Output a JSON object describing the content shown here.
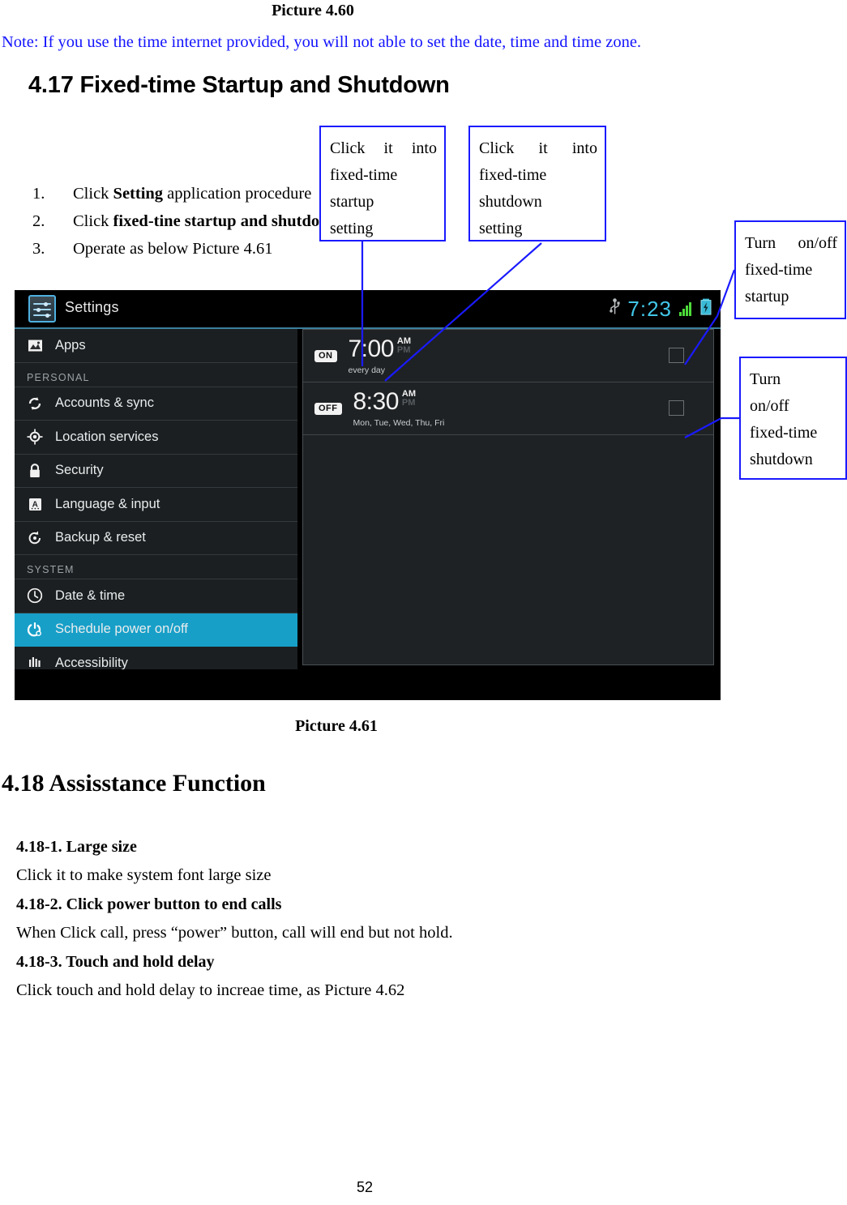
{
  "document": {
    "caption_top": "Picture 4.60",
    "note": "Note: If you use the time internet provided, you will not able to set the date, time and time zone.",
    "note_color": "#1414ff",
    "heading_417": "4.17 Fixed-time Startup and Shutdown",
    "steps": [
      {
        "num": "1.",
        "pre": "Click ",
        "bold": "Setting",
        "post": " application procedure"
      },
      {
        "num": "2.",
        "pre": "Click ",
        "bold": "fixed-tine startup and shutdown",
        "post": ""
      },
      {
        "num": "3.",
        "pre": "Operate as below Picture 4.61",
        "bold": "",
        "post": ""
      }
    ],
    "caption_bottom": "Picture 4.61",
    "heading_418": "4.18 Assisstance Function",
    "subsections": [
      {
        "head": "4.18-1. Large size",
        "body": "Click it to make system font large size"
      },
      {
        "head": "4.18-2. Click power button to end calls",
        "body": "When Click call, press “power” button, call will end but not hold."
      },
      {
        "head": "4.18-3. Touch and hold delay",
        "body": "Click touch and hold delay to increae time, as Picture 4.62"
      }
    ],
    "page_number": "52"
  },
  "callouts": {
    "border_color": "#1a1aff",
    "startup": {
      "l1a": "Click",
      "l1b": "it",
      "l1c": "into",
      "l2": "fixed-time",
      "l3": "startup",
      "l4": "setting"
    },
    "shutdown": {
      "l1a": "Click",
      "l1b": "it",
      "l1c": "into",
      "l2": "fixed-time",
      "l3": "shutdown",
      "l4": "setting"
    },
    "turn_startup": {
      "l1a": "Turn",
      "l1b": "on/off",
      "l2": "fixed-time",
      "l3": "startup"
    },
    "turn_shutdown": {
      "l1": "Turn",
      "l2": "on/off",
      "l3": "fixed-time",
      "l4": "shutdown"
    }
  },
  "android": {
    "action_bar": {
      "title": "Settings",
      "clock": "7:23",
      "icons": [
        "usb-icon",
        "signal-icon",
        "battery-charging-icon"
      ]
    },
    "sidebar": [
      {
        "type": "item",
        "label": "Apps",
        "icon": "apps-icon",
        "selected": false
      },
      {
        "type": "header",
        "label": "PERSONAL"
      },
      {
        "type": "item",
        "label": "Accounts & sync",
        "icon": "sync-icon",
        "selected": false
      },
      {
        "type": "item",
        "label": "Location services",
        "icon": "location-icon",
        "selected": false
      },
      {
        "type": "item",
        "label": "Security",
        "icon": "lock-icon",
        "selected": false
      },
      {
        "type": "item",
        "label": "Language & input",
        "icon": "keyboard-icon",
        "selected": false
      },
      {
        "type": "item",
        "label": "Backup & reset",
        "icon": "backup-icon",
        "selected": false
      },
      {
        "type": "header",
        "label": "SYSTEM"
      },
      {
        "type": "item",
        "label": "Date & time",
        "icon": "clock-icon",
        "selected": false
      },
      {
        "type": "item",
        "label": "Schedule power on/off",
        "icon": "power-icon",
        "selected": true
      },
      {
        "type": "item",
        "label": "Accessibility",
        "icon": "accessibility-icon",
        "selected": false
      }
    ],
    "selected_accent": "#179fc8",
    "alarms": [
      {
        "badge": "ON",
        "time": "7:00",
        "am": "AM",
        "pm": "PM",
        "active": "AM",
        "days": "every day",
        "checked": false
      },
      {
        "badge": "OFF",
        "time": "8:30",
        "am": "AM",
        "pm": "PM",
        "active": "AM",
        "days": "Mon, Tue, Wed, Thu, Fri",
        "checked": false
      }
    ]
  }
}
